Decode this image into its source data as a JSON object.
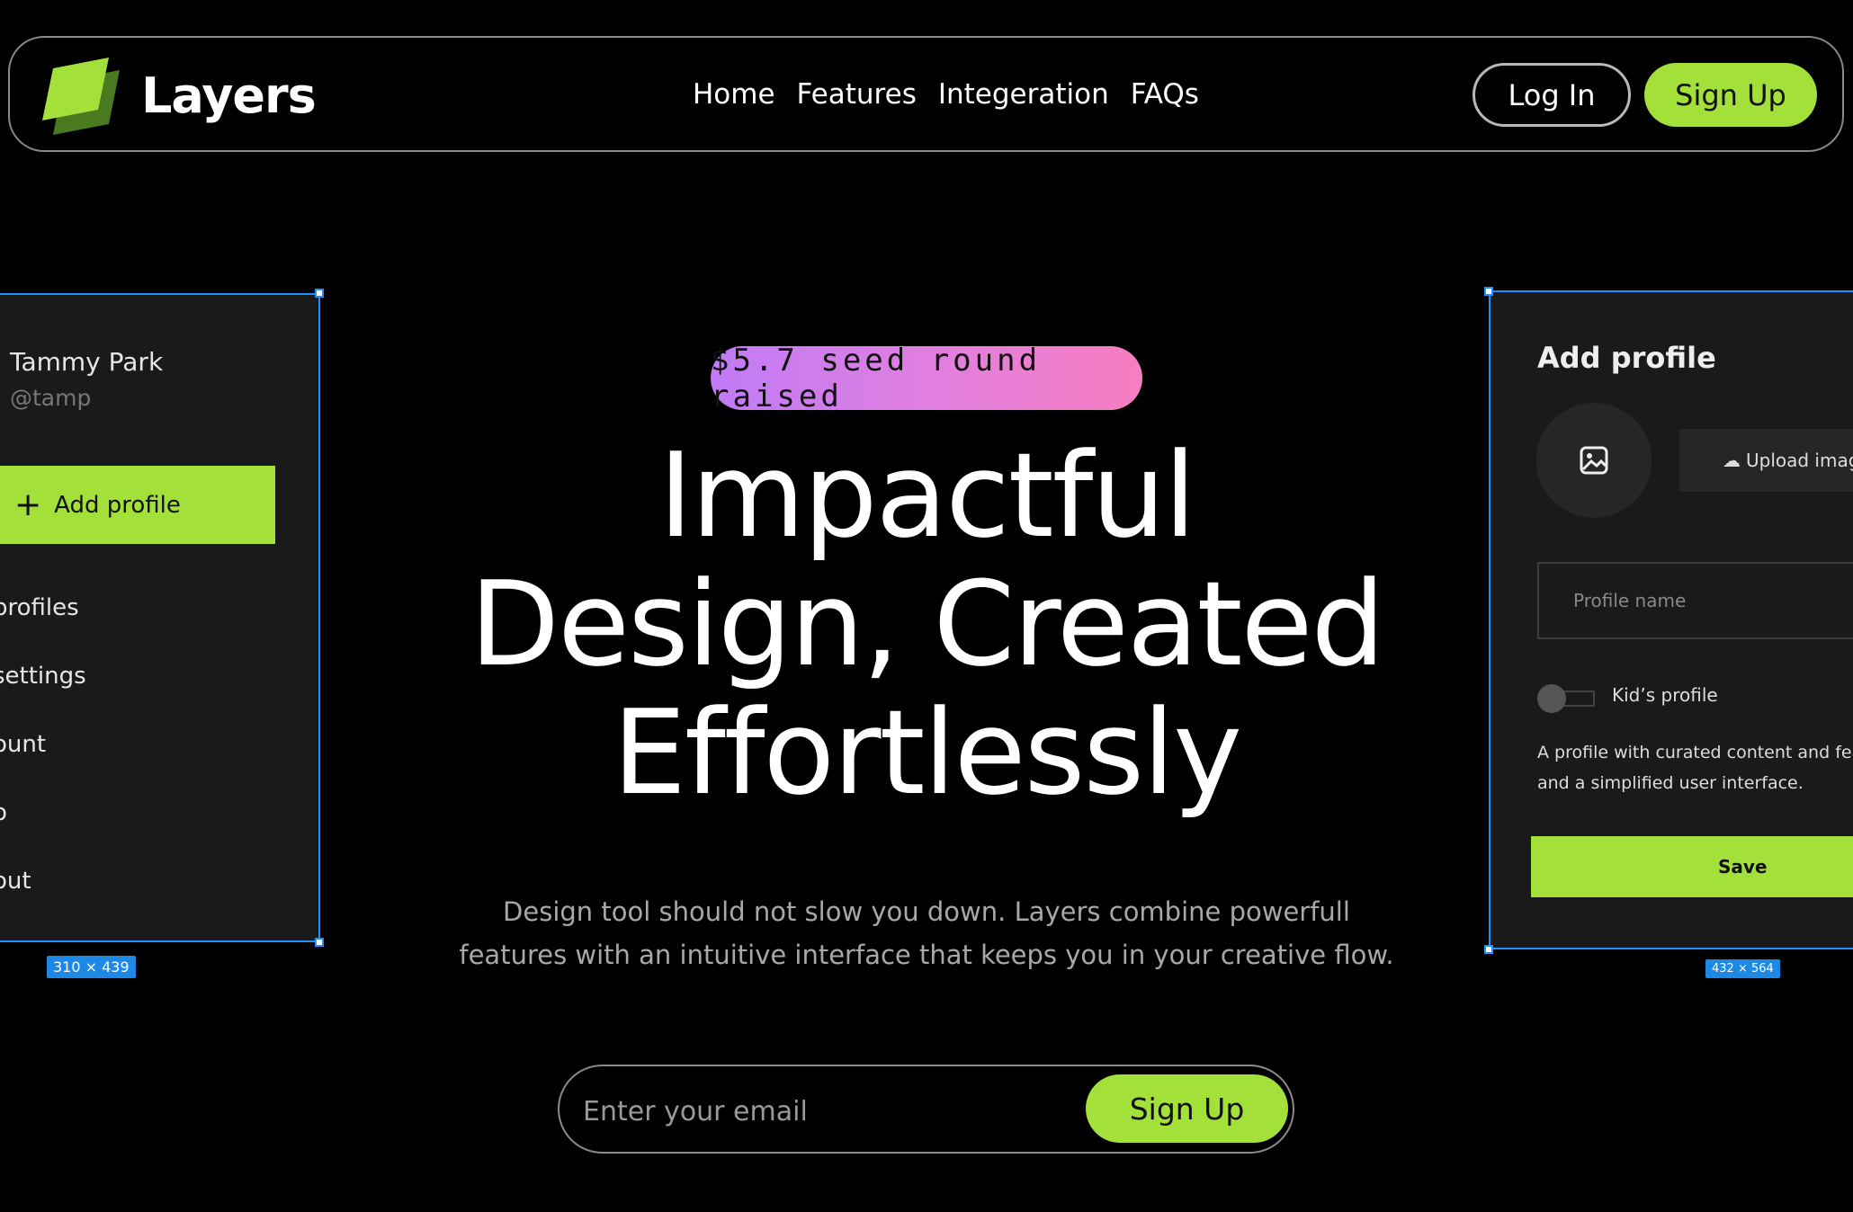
{
  "brand": {
    "name": "Layers",
    "accent": "#a4e03a"
  },
  "nav": {
    "links": [
      "Home",
      "Features",
      "Integeration",
      "FAQs"
    ],
    "login": "Log In",
    "signup": "Sign Up"
  },
  "left_mock": {
    "name": "Tammy Park",
    "handle": "@tamp",
    "add_profile": "Add profile",
    "menu": [
      "profiles",
      "settings",
      "ount",
      "o",
      "out"
    ],
    "size": "310 × 439"
  },
  "right_mock": {
    "title": "Add profile",
    "upload": "Upload imag",
    "placeholder": "Profile name",
    "toggle_label": "Kid’s profile",
    "desc_line1": "A profile with curated content and feat",
    "desc_line2": "and a simplified user interface.",
    "save": "Save",
    "size": "432 × 564"
  },
  "hero": {
    "badge": "$5.7 seed round raised",
    "headline_line1": "Impactful",
    "headline_line2": "Design, Created",
    "headline_line3": "Effortlessly",
    "subtitle_line1": "Design tool should not slow you down. Layers combine powerfull",
    "subtitle_line2": "features with an intuitive interface that keeps you in your creative flow.",
    "email_placeholder": "Enter your email",
    "signup": "Sign Up"
  }
}
